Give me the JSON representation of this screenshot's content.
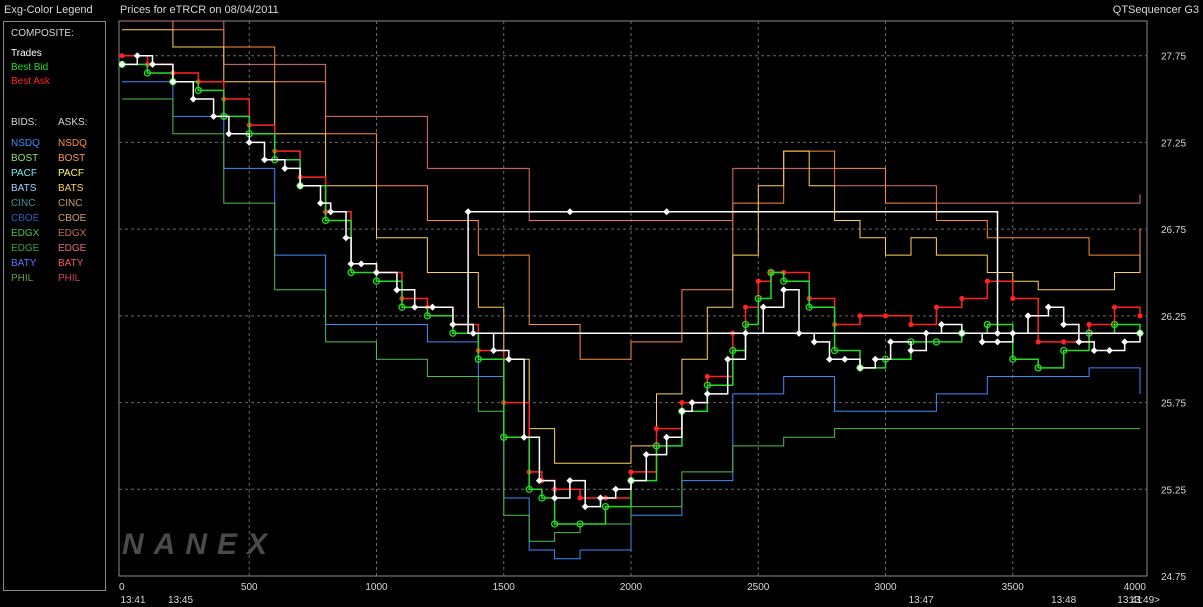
{
  "header": {
    "legend_title": "Exg-Color Legend",
    "chart_title": "Prices for  eTRCR  on  08/04/2011",
    "app_name": "QTSequencer G3"
  },
  "legend": {
    "composite_label": "COMPOSITE:",
    "composite_items": [
      {
        "label": "Trades",
        "color": "#ffffff"
      },
      {
        "label": "Best Bid",
        "color": "#22dd22"
      },
      {
        "label": "Best Ask",
        "color": "#ff2222"
      }
    ],
    "bids_label": "BIDS:",
    "asks_label": "ASKS:",
    "exchanges": [
      {
        "bid": "NSDQ",
        "ask": "NSDQ",
        "bid_color": "#3b8cff",
        "ask_color": "#ff8c3b"
      },
      {
        "bid": "BOST",
        "ask": "BOST",
        "bid_color": "#9bdc6a",
        "ask_color": "#ff9a5a"
      },
      {
        "bid": "PACF",
        "ask": "PACF",
        "bid_color": "#7cf0f0",
        "ask_color": "#ffff66"
      },
      {
        "bid": "BATS",
        "ask": "BATS",
        "bid_color": "#9fd0ff",
        "ask_color": "#ffd24d"
      },
      {
        "bid": "CINC",
        "ask": "CINC",
        "bid_color": "#3a9a9a",
        "ask_color": "#c8a060"
      },
      {
        "bid": "CBOE",
        "ask": "CBOE",
        "bid_color": "#2a5fc0",
        "ask_color": "#d0a070"
      },
      {
        "bid": "EDGX",
        "ask": "EDGX",
        "bid_color": "#4fbf4f",
        "ask_color": "#c07050"
      },
      {
        "bid": "EDGE",
        "ask": "EDGE",
        "bid_color": "#3f9f3f",
        "ask_color": "#e07070"
      },
      {
        "bid": "BATY",
        "ask": "BATY",
        "bid_color": "#5a7aff",
        "ask_color": "#ff5a5a"
      },
      {
        "bid": "PHIL",
        "ask": "PHIL",
        "bid_color": "#6a9f3a",
        "ask_color": "#d04060"
      }
    ]
  },
  "watermark": "NANEX",
  "chart_data": {
    "type": "line",
    "title": "Prices for  eTRCR  on  08/04/2011",
    "xlim": [
      0,
      4000
    ],
    "ylim": [
      24.75,
      28.0
    ],
    "x_ticks": [
      "0",
      "500",
      "1000",
      "1500",
      "2000",
      "2500",
      "3000",
      "3500",
      "4000"
    ],
    "x_tick_values": [
      0,
      500,
      1000,
      1500,
      2000,
      2500,
      3000,
      3500,
      4000
    ],
    "y_ticks": [
      "27.75",
      "27.25",
      "26.75",
      "26.25",
      "25.75",
      "25.25",
      "24.75"
    ],
    "y_tick_values": [
      27.75,
      27.25,
      26.75,
      26.25,
      25.75,
      25.25,
      24.75
    ],
    "time_labels": [
      {
        "x": 0,
        "label": "13:41"
      },
      {
        "x": 230,
        "label": "13:45"
      },
      {
        "x": 3140,
        "label": "13:47"
      },
      {
        "x": 3700,
        "label": "13:48"
      },
      {
        "x": 3960,
        "label": "13:41"
      },
      {
        "x": 4070,
        "label": "13:49>"
      }
    ],
    "grid": true,
    "grid_style": "dashed",
    "series": [
      {
        "name": "Best Bid",
        "color": "#22dd22",
        "marker": "circle",
        "x": [
          0,
          100,
          200,
          300,
          400,
          500,
          600,
          700,
          800,
          900,
          1000,
          1100,
          1200,
          1300,
          1400,
          1500,
          1600,
          1650,
          1700,
          1800,
          1900,
          2000,
          2100,
          2200,
          2300,
          2400,
          2450,
          2500,
          2550,
          2600,
          2700,
          2800,
          2900,
          3000,
          3100,
          3200,
          3300,
          3400,
          3500,
          3600,
          3700,
          3800,
          3900,
          4000
        ],
        "y": [
          27.7,
          27.65,
          27.6,
          27.55,
          27.4,
          27.3,
          27.15,
          27.0,
          26.8,
          26.5,
          26.45,
          26.3,
          26.25,
          26.15,
          26.0,
          25.55,
          25.25,
          25.2,
          25.05,
          25.05,
          25.15,
          25.3,
          25.5,
          25.7,
          25.85,
          26.05,
          26.2,
          26.35,
          26.5,
          26.45,
          26.3,
          26.05,
          25.95,
          26.0,
          26.1,
          26.1,
          26.15,
          26.2,
          26.0,
          25.95,
          26.05,
          26.15,
          26.2,
          26.15
        ]
      },
      {
        "name": "Best Ask",
        "color": "#ff2222",
        "marker": "dot",
        "x": [
          0,
          100,
          200,
          300,
          400,
          500,
          600,
          700,
          800,
          900,
          1000,
          1100,
          1200,
          1300,
          1400,
          1500,
          1600,
          1650,
          1700,
          1800,
          1900,
          2000,
          2100,
          2200,
          2300,
          2400,
          2450,
          2500,
          2550,
          2600,
          2700,
          2800,
          2900,
          3000,
          3100,
          3200,
          3300,
          3400,
          3500,
          3600,
          3700,
          3800,
          3900,
          4000
        ],
        "y": [
          27.75,
          27.7,
          27.65,
          27.6,
          27.5,
          27.35,
          27.2,
          27.05,
          26.85,
          26.55,
          26.5,
          26.35,
          26.3,
          26.2,
          26.05,
          25.75,
          25.35,
          25.3,
          25.25,
          25.2,
          25.2,
          25.35,
          25.6,
          25.75,
          25.9,
          26.15,
          26.3,
          26.45,
          26.5,
          26.5,
          26.35,
          26.2,
          26.25,
          26.25,
          26.2,
          26.3,
          26.35,
          26.45,
          26.35,
          26.1,
          26.1,
          26.2,
          26.3,
          26.25
        ]
      },
      {
        "name": "Trades",
        "color": "#ffffff",
        "marker": "diamond",
        "x": [
          0,
          60,
          120,
          200,
          280,
          360,
          420,
          500,
          560,
          640,
          700,
          780,
          820,
          880,
          900,
          940,
          1000,
          1080,
          1150,
          1220,
          1300,
          1380,
          1460,
          1520,
          1580,
          1640,
          1700,
          1760,
          1820,
          1880,
          1940,
          2000,
          2060,
          2140,
          2200,
          2240,
          2300,
          2380,
          2450,
          2520,
          2600,
          2660,
          2720,
          2780,
          2840,
          2900,
          2960,
          3020,
          3100,
          3160,
          3220,
          3300,
          3380,
          3440,
          3500,
          3560,
          3640,
          3700,
          3760,
          3820,
          3880,
          3940,
          4000,
          1360,
          1760,
          2140,
          3440
        ],
        "y": [
          27.7,
          27.75,
          27.7,
          27.6,
          27.5,
          27.4,
          27.3,
          27.25,
          27.15,
          27.1,
          27.0,
          26.9,
          26.85,
          26.7,
          26.55,
          26.55,
          26.5,
          26.4,
          26.3,
          26.3,
          26.2,
          26.15,
          26.05,
          26.0,
          25.55,
          25.3,
          25.2,
          25.3,
          25.15,
          25.2,
          25.25,
          25.3,
          25.45,
          25.55,
          25.7,
          25.75,
          25.8,
          26.0,
          26.15,
          26.3,
          26.4,
          26.15,
          26.1,
          26.0,
          26.0,
          25.95,
          26.0,
          26.1,
          26.05,
          26.15,
          26.2,
          26.15,
          26.1,
          26.1,
          26.15,
          26.25,
          26.3,
          26.2,
          26.1,
          26.05,
          26.05,
          26.1,
          26.15,
          26.85,
          26.85,
          26.85,
          26.15
        ]
      },
      {
        "name": "NSDQ",
        "color": "#3b8cff",
        "x": [
          0,
          200,
          400,
          600,
          800,
          1000,
          1200,
          1400,
          1500,
          1600,
          1700,
          1800,
          2000,
          2200,
          2400,
          2600,
          2800,
          3000,
          3200,
          3400,
          3600,
          3800,
          4000
        ],
        "y": [
          27.6,
          27.4,
          27.1,
          26.6,
          26.2,
          26.2,
          26.1,
          25.9,
          25.2,
          24.9,
          24.85,
          24.9,
          25.1,
          25.3,
          25.8,
          25.9,
          25.7,
          25.7,
          25.8,
          25.9,
          25.9,
          25.95,
          25.8
        ]
      },
      {
        "name": "EDGX",
        "color": "#4fbf4f",
        "x": [
          0,
          200,
          400,
          600,
          800,
          1000,
          1200,
          1400,
          1500,
          1600,
          1700,
          1800,
          2000,
          2200,
          2400,
          2600,
          2800,
          3000,
          3200,
          3400,
          3600,
          3800,
          4000
        ],
        "y": [
          27.5,
          27.3,
          26.9,
          26.4,
          26.1,
          26.0,
          25.9,
          25.7,
          25.1,
          24.95,
          25.0,
          25.05,
          25.15,
          25.35,
          25.5,
          25.55,
          25.6,
          25.6,
          25.6,
          25.6,
          25.6,
          25.6,
          25.6
        ]
      },
      {
        "name": "BATS",
        "color": "#ffd24d",
        "x": [
          0,
          200,
          400,
          600,
          800,
          1000,
          1200,
          1400,
          1500,
          1600,
          1700,
          1800,
          1900,
          2000,
          2100,
          2200,
          2300,
          2400,
          2500,
          2600,
          2700,
          2800,
          2900,
          3000,
          3100,
          3200,
          3300,
          3400,
          3500,
          3600,
          3700,
          3800,
          3900,
          4000
        ],
        "y": [
          27.9,
          27.8,
          27.6,
          27.3,
          27.0,
          26.7,
          26.5,
          26.3,
          26.0,
          25.6,
          25.4,
          25.4,
          25.4,
          25.5,
          25.8,
          26.0,
          26.3,
          26.6,
          27.0,
          27.2,
          27.0,
          26.8,
          26.7,
          26.6,
          26.7,
          26.6,
          26.6,
          26.5,
          26.45,
          26.4,
          26.4,
          26.4,
          26.5,
          26.6
        ]
      },
      {
        "name": "NSDQ",
        "color": "#ff8c3b",
        "x": [
          0,
          200,
          400,
          600,
          800,
          1000,
          1200,
          1400,
          1600,
          1800,
          2000,
          2200,
          2400,
          2600,
          2800,
          3000,
          3200,
          3400,
          3600,
          3800,
          4000
        ],
        "y": [
          27.95,
          27.9,
          27.8,
          27.6,
          27.3,
          27.0,
          26.8,
          26.6,
          26.2,
          26.0,
          26.1,
          26.4,
          26.9,
          27.2,
          27.1,
          26.9,
          26.8,
          26.7,
          26.7,
          26.6,
          26.75
        ]
      },
      {
        "name": "EDGE",
        "color": "#e07070",
        "x": [
          0,
          400,
          800,
          1200,
          1600,
          2000,
          2400,
          2800,
          3200,
          3600,
          4000
        ],
        "y": [
          27.95,
          27.7,
          27.4,
          27.1,
          26.8,
          26.8,
          27.1,
          27.0,
          26.9,
          26.9,
          26.95
        ]
      }
    ]
  }
}
